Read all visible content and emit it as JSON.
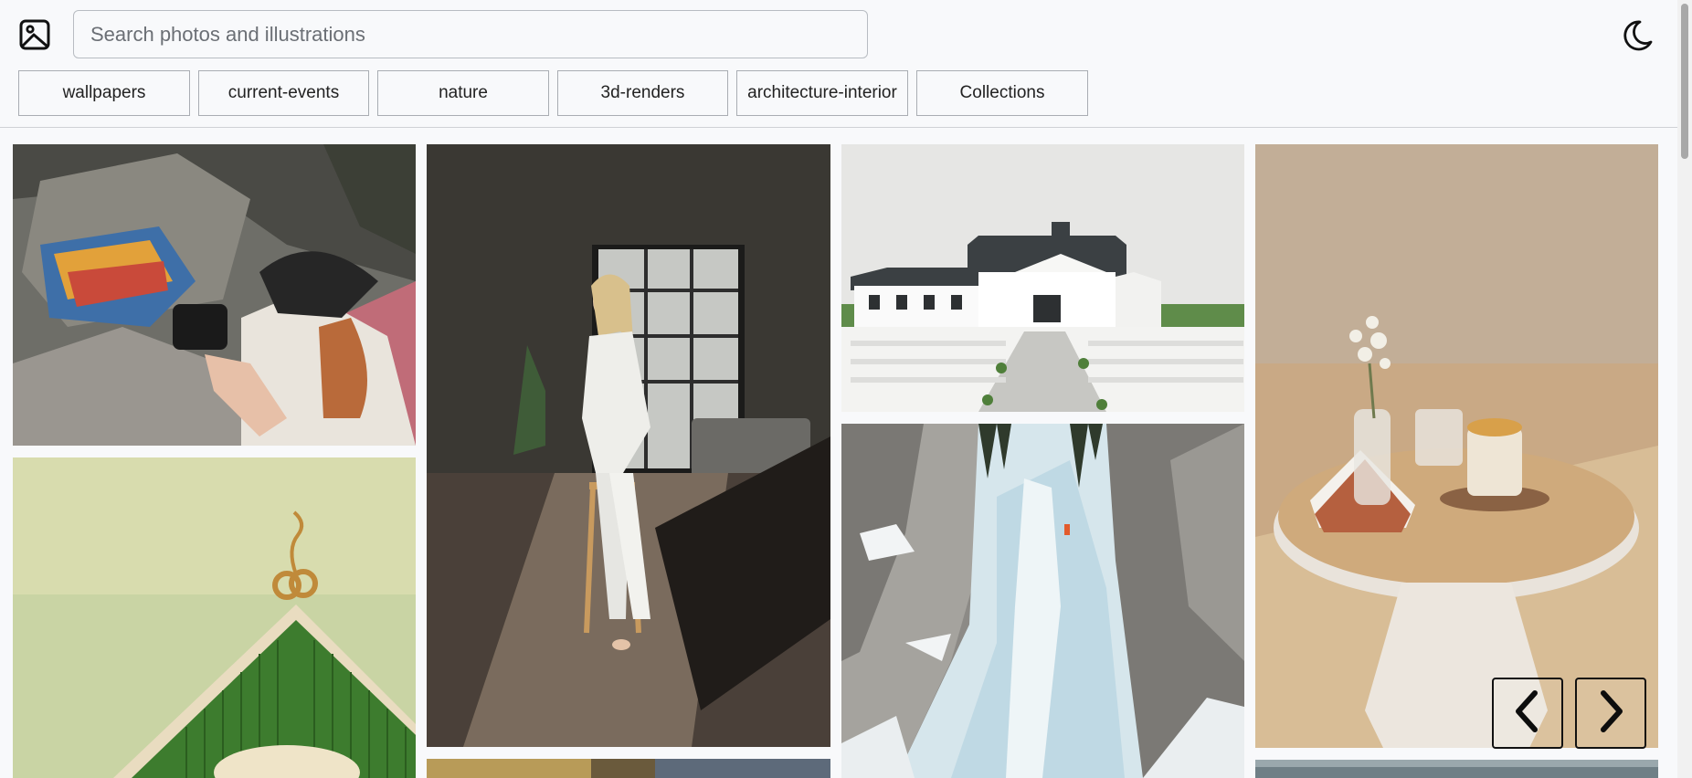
{
  "search": {
    "placeholder": "Search photos and illustrations"
  },
  "topics": [
    "wallpapers",
    "current-events",
    "nature",
    "3d-renders",
    "architecture-interior",
    "Collections"
  ],
  "icons": {
    "logo": "image-icon",
    "theme": "moon-icon",
    "prev": "chevron-left-icon",
    "next": "chevron-right-icon"
  },
  "colors": {
    "background": "#f8f9fb",
    "border": "#a9adb3"
  }
}
